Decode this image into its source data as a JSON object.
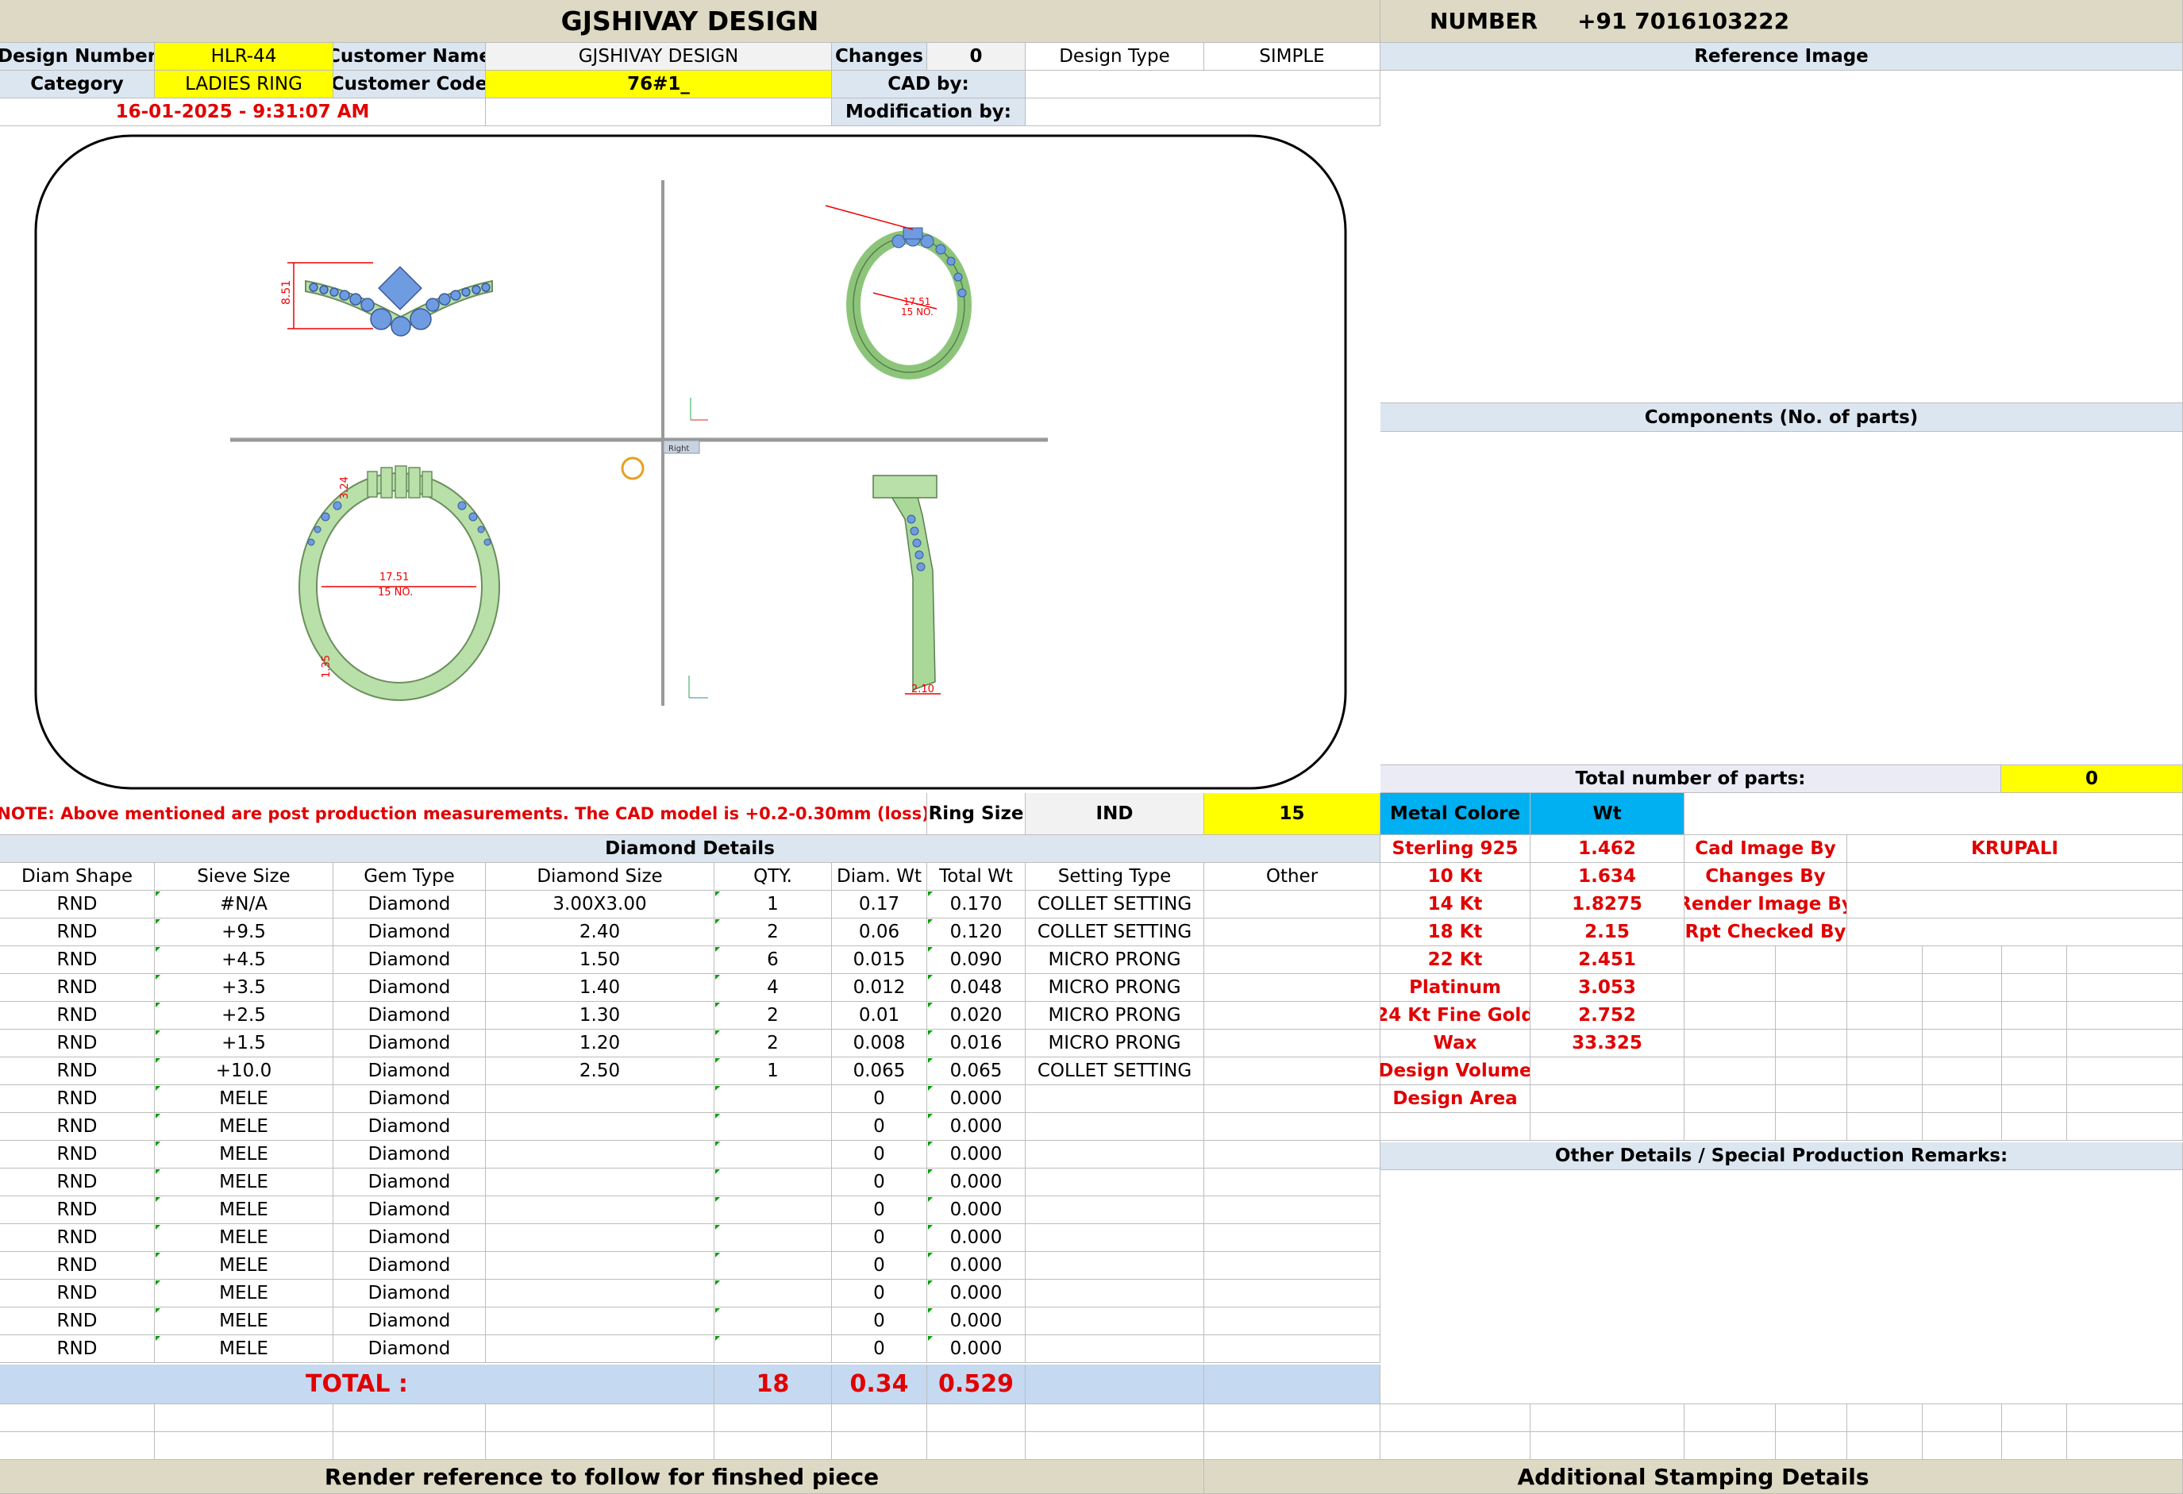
{
  "header": {
    "title": "GJSHIVAY DESIGN",
    "number_label": "NUMBER",
    "number_value": "+91 7016103222"
  },
  "info": {
    "design_number_label": "Design Number",
    "design_number": "HLR-44",
    "customer_name_label": "Customer Name",
    "customer_name": "GJSHIVAY DESIGN",
    "changes_label": "Changes",
    "changes": "0",
    "design_type_label": "Design Type",
    "design_type": "SIMPLE",
    "category_label": "Category",
    "category": "LADIES RING",
    "customer_code_label": "Customer Code",
    "customer_code": "76#1_",
    "cad_by_label": "CAD by:",
    "modification_by_label": "Modification by:",
    "timestamp": "16-01-2025 - 9:31:07 AM"
  },
  "right_panel": {
    "reference_image": "Reference Image",
    "components": "Components (No. of parts)",
    "total_parts_label": "Total number of parts:",
    "total_parts": "0"
  },
  "drawing": {
    "top_left_dim": "8.51",
    "top_right_dim1": "17.51",
    "top_right_dim2": "15 NO.",
    "bottom_left_dim1": "17.51",
    "bottom_left_dim2": "15 NO.",
    "bottom_left_top": "3.24",
    "bottom_left_bottom": "1.35",
    "bottom_right_dim": "2.10",
    "view_label": "Right"
  },
  "note": "NOTE: Above mentioned are post production measurements. The CAD model is +0.2-0.30mm (loss)",
  "ring_size": {
    "label": "Ring Size",
    "standard": "IND",
    "value": "15"
  },
  "metal": {
    "header_label": "Metal Colore",
    "header_wt": "Wt",
    "rows": [
      {
        "name": "Sterling 925",
        "wt": "1.462"
      },
      {
        "name": "10 Kt",
        "wt": "1.634"
      },
      {
        "name": "14 Kt",
        "wt": "1.8275"
      },
      {
        "name": "18 Kt",
        "wt": "2.15"
      },
      {
        "name": "22 Kt",
        "wt": "2.451"
      },
      {
        "name": "Platinum",
        "wt": "3.053"
      },
      {
        "name": "24 Kt Fine Gold",
        "wt": "2.752"
      },
      {
        "name": "Wax",
        "wt": "33.325"
      },
      {
        "name": "Design Volume",
        "wt": ""
      },
      {
        "name": "Design Area",
        "wt": ""
      }
    ]
  },
  "credits": [
    {
      "label": "Cad Image By",
      "value": "KRUPALI"
    },
    {
      "label": "Changes By",
      "value": ""
    },
    {
      "label": "Render Image By",
      "value": ""
    },
    {
      "label": "Rpt Checked By",
      "value": ""
    }
  ],
  "diamond": {
    "title": "Diamond Details",
    "headers": [
      "Diam Shape",
      "Sieve Size",
      "Gem Type",
      "Diamond Size",
      "QTY.",
      "Diam. Wt",
      "Total Wt",
      "Setting Type",
      "Other"
    ],
    "rows": [
      [
        "RND",
        "#N/A",
        "Diamond",
        "3.00X3.00",
        "1",
        "0.17",
        "0.170",
        "COLLET SETTING",
        ""
      ],
      [
        "RND",
        "+9.5",
        "Diamond",
        "2.40",
        "2",
        "0.06",
        "0.120",
        "COLLET SETTING",
        ""
      ],
      [
        "RND",
        "+4.5",
        "Diamond",
        "1.50",
        "6",
        "0.015",
        "0.090",
        "MICRO PRONG",
        ""
      ],
      [
        "RND",
        "+3.5",
        "Diamond",
        "1.40",
        "4",
        "0.012",
        "0.048",
        "MICRO PRONG",
        ""
      ],
      [
        "RND",
        "+2.5",
        "Diamond",
        "1.30",
        "2",
        "0.01",
        "0.020",
        "MICRO PRONG",
        ""
      ],
      [
        "RND",
        "+1.5",
        "Diamond",
        "1.20",
        "2",
        "0.008",
        "0.016",
        "MICRO PRONG",
        ""
      ],
      [
        "RND",
        "+10.0",
        "Diamond",
        "2.50",
        "1",
        "0.065",
        "0.065",
        "COLLET SETTING",
        ""
      ],
      [
        "RND",
        "MELE",
        "Diamond",
        "",
        "",
        "0",
        "0.000",
        "",
        ""
      ],
      [
        "RND",
        "MELE",
        "Diamond",
        "",
        "",
        "0",
        "0.000",
        "",
        ""
      ],
      [
        "RND",
        "MELE",
        "Diamond",
        "",
        "",
        "0",
        "0.000",
        "",
        ""
      ],
      [
        "RND",
        "MELE",
        "Diamond",
        "",
        "",
        "0",
        "0.000",
        "",
        ""
      ],
      [
        "RND",
        "MELE",
        "Diamond",
        "",
        "",
        "0",
        "0.000",
        "",
        ""
      ],
      [
        "RND",
        "MELE",
        "Diamond",
        "",
        "",
        "0",
        "0.000",
        "",
        ""
      ],
      [
        "RND",
        "MELE",
        "Diamond",
        "",
        "",
        "0",
        "0.000",
        "",
        ""
      ],
      [
        "RND",
        "MELE",
        "Diamond",
        "",
        "",
        "0",
        "0.000",
        "",
        ""
      ],
      [
        "RND",
        "MELE",
        "Diamond",
        "",
        "",
        "0",
        "0.000",
        "",
        ""
      ],
      [
        "RND",
        "MELE",
        "Diamond",
        "",
        "",
        "0",
        "0.000",
        "",
        ""
      ]
    ],
    "total_label": "TOTAL :",
    "total_qty": "18",
    "total_diam_wt": "0.34",
    "total_wt": "0.529"
  },
  "other_details": "Other Details / Special Production Remarks:",
  "footer": {
    "left": "Render reference to follow for finshed piece",
    "right": "Additional Stamping Details"
  }
}
